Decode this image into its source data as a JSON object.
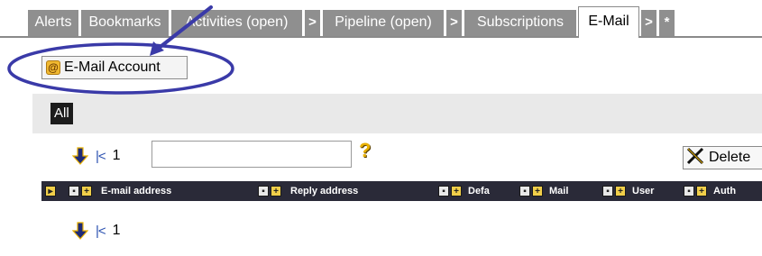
{
  "tabs": [
    {
      "label": "Alerts"
    },
    {
      "label": "Bookmarks"
    },
    {
      "label": "Activities (open)"
    },
    {
      "label": ">"
    },
    {
      "label": "Pipeline (open)"
    },
    {
      "label": ">"
    },
    {
      "label": "Subscriptions"
    },
    {
      "label": "E-Mail",
      "active": true
    },
    {
      "label": ">"
    },
    {
      "label": "*"
    }
  ],
  "account_button": {
    "label": "E-Mail Account",
    "icon": "at-sign-icon"
  },
  "filter": {
    "all_label": "All"
  },
  "pager_top": {
    "first_symbol": "|<",
    "page": "1"
  },
  "search": {
    "value": "",
    "help_symbol": "?"
  },
  "delete_button": {
    "label": "Delete"
  },
  "table_header": {
    "columns": [
      {
        "label": "E-mail address"
      },
      {
        "label": "Reply address"
      },
      {
        "label": "Defa"
      },
      {
        "label": "Mail"
      },
      {
        "label": "User"
      },
      {
        "label": "Auth"
      }
    ]
  },
  "pager_bottom": {
    "first_symbol": "|<",
    "page": "1"
  },
  "colors": {
    "tab_bg": "#8f8f8f",
    "header_bg": "#2a2a38",
    "annotation": "#3a3aa8",
    "band": "#e9e9e9"
  }
}
